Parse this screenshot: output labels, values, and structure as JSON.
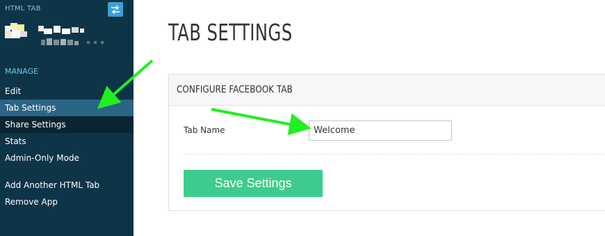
{
  "sidebar": {
    "brand": "HTML TAB",
    "section_label": "MANAGE",
    "items": [
      {
        "label": "Edit"
      },
      {
        "label": "Tab Settings"
      },
      {
        "label": "Share Settings"
      },
      {
        "label": "Stats"
      },
      {
        "label": "Admin-Only Mode"
      },
      {
        "label": "Add Another HTML Tab"
      },
      {
        "label": "Remove App"
      }
    ]
  },
  "main": {
    "title": "TAB SETTINGS",
    "panel": {
      "title": "CONFIGURE FACEBOOK TAB",
      "field_label": "Tab Name",
      "field_value": "Welcome",
      "save_label": "Save Settings"
    }
  },
  "colors": {
    "sidebar_bg": "#0e3447",
    "active_item": "#2a6584",
    "accent": "#3aa1d6",
    "save_button": "#3dcc8e",
    "annotation_arrow": "#22ee22"
  },
  "icons": {
    "swap": "swap-arrows-icon"
  }
}
